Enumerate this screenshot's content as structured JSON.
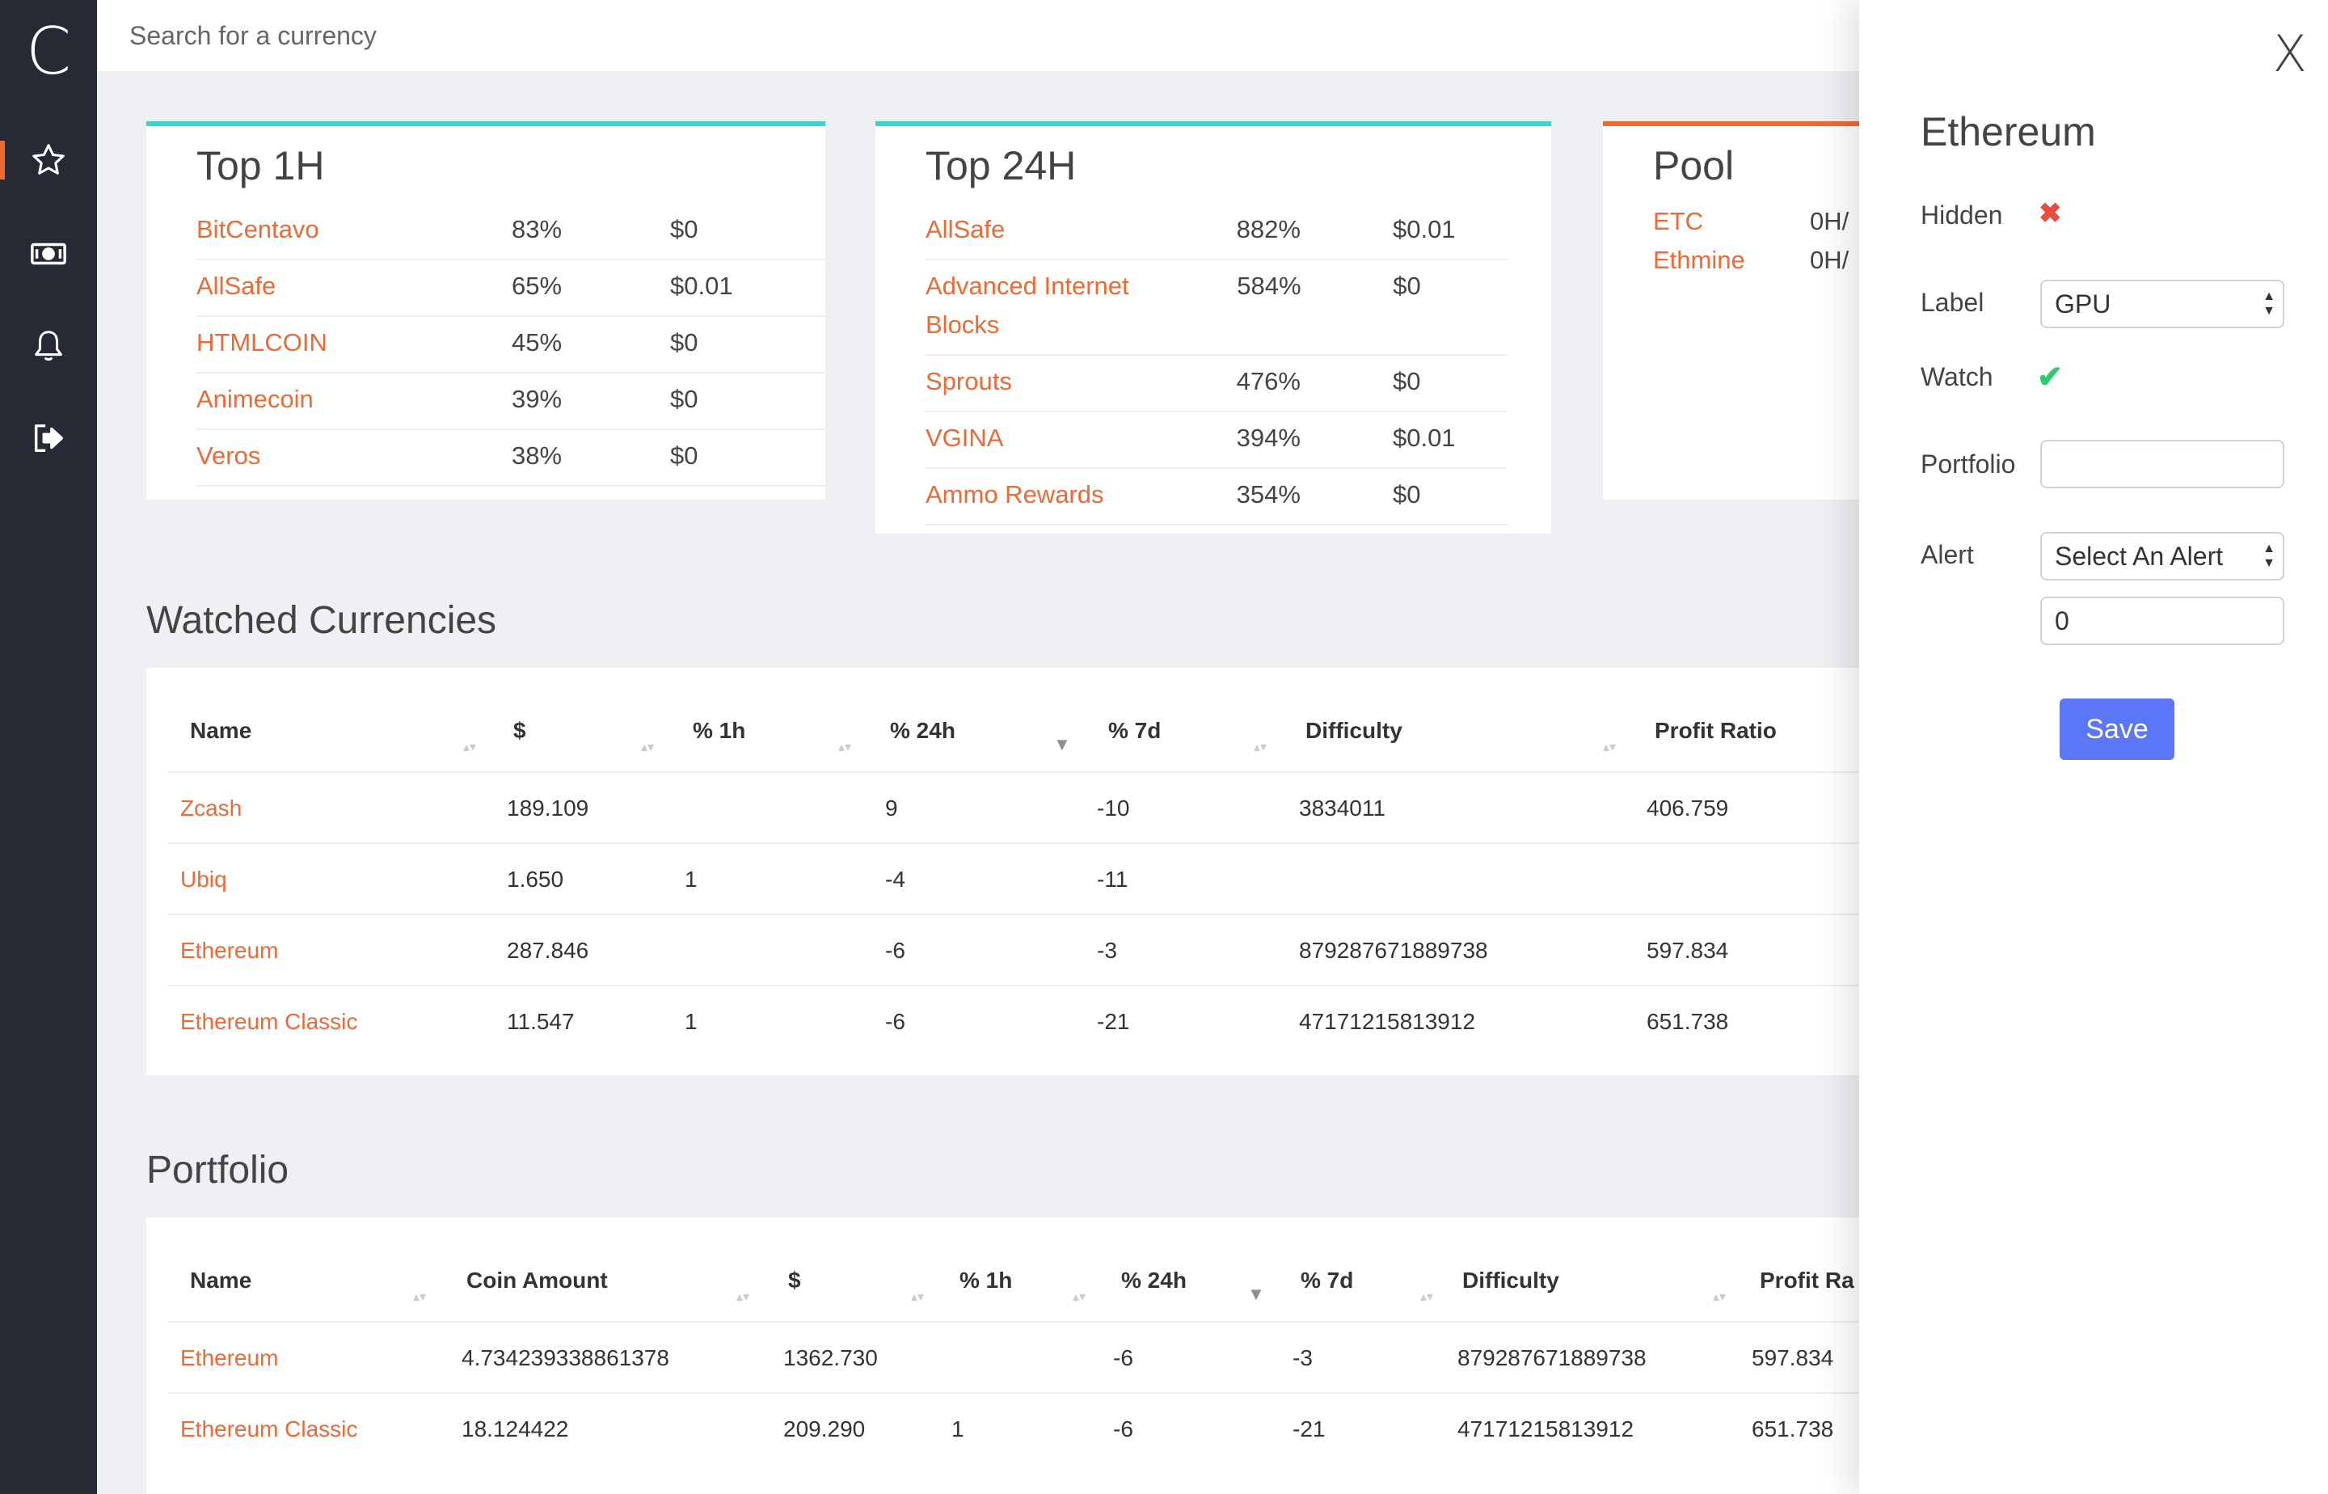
{
  "app": {
    "logo": "C"
  },
  "sidebar": {
    "items": [
      {
        "name": "favorites",
        "icon": "star-icon"
      },
      {
        "name": "money",
        "icon": "money-icon"
      },
      {
        "name": "alerts",
        "icon": "bell-icon"
      },
      {
        "name": "logout",
        "icon": "sign-out-icon"
      }
    ]
  },
  "search": {
    "placeholder": "Search for a currency"
  },
  "top1h": {
    "title": "Top 1H",
    "rows": [
      {
        "name": "BitCentavo",
        "pct": "83%",
        "price": "$0"
      },
      {
        "name": "AllSafe",
        "pct": "65%",
        "price": "$0.01"
      },
      {
        "name": "HTMLCOIN",
        "pct": "45%",
        "price": "$0"
      },
      {
        "name": "Animecoin",
        "pct": "39%",
        "price": "$0"
      },
      {
        "name": "Veros",
        "pct": "38%",
        "price": "$0"
      }
    ]
  },
  "top24h": {
    "title": "Top 24H",
    "rows": [
      {
        "name": "AllSafe",
        "pct": "882%",
        "price": "$0.01"
      },
      {
        "name": "Advanced Internet Blocks",
        "pct": "584%",
        "price": "$0"
      },
      {
        "name": "Sprouts",
        "pct": "476%",
        "price": "$0"
      },
      {
        "name": "VGINA",
        "pct": "394%",
        "price": "$0.01"
      },
      {
        "name": "Ammo Rewards",
        "pct": "354%",
        "price": "$0"
      }
    ]
  },
  "pool": {
    "title": "Pool",
    "rows": [
      {
        "name": "ETC",
        "value": "0H/"
      },
      {
        "name": "Ethmine",
        "value": "0H/"
      }
    ]
  },
  "watched": {
    "title": "Watched Currencies",
    "headers": [
      "Name",
      "$",
      "% 1h",
      "% 24h",
      "% 7d",
      "Difficulty",
      "Profit Ratio"
    ],
    "rows": [
      [
        "Zcash",
        "189.109",
        "",
        "9",
        "-10",
        "3834011",
        "406.759"
      ],
      [
        "Ubiq",
        "1.650",
        "1",
        "-4",
        "-11",
        "",
        ""
      ],
      [
        "Ethereum",
        "287.846",
        "",
        "-6",
        "-3",
        "879287671889738",
        "597.834"
      ],
      [
        "Ethereum Classic",
        "11.547",
        "1",
        "-6",
        "-21",
        "47171215813912",
        "651.738"
      ]
    ]
  },
  "portfolio": {
    "title": "Portfolio",
    "headers": [
      "Name",
      "Coin Amount",
      "$",
      "% 1h",
      "% 24h",
      "% 7d",
      "Difficulty",
      "Profit Ra"
    ],
    "rows": [
      [
        "Ethereum",
        "4.734239338861378",
        "1362.730",
        "",
        "-6",
        "-3",
        "879287671889738",
        "597.834"
      ],
      [
        "Ethereum Classic",
        "18.124422",
        "209.290",
        "1",
        "-6",
        "-21",
        "47171215813912",
        "651.738"
      ]
    ]
  },
  "drawer": {
    "close": "X",
    "title": "Ethereum",
    "hidden_label": "Hidden",
    "hidden_mark": "✖",
    "label_label": "Label",
    "label_value": "GPU",
    "watch_label": "Watch",
    "watch_mark": "✔",
    "portfolio_label": "Portfolio",
    "portfolio_value": "",
    "alert_label": "Alert",
    "alert_value": "Select An Alert",
    "alert_amount": "0",
    "save_label": "Save"
  },
  "colors": {
    "accent": "#ee6a35",
    "teal": "#3dd5c8",
    "sidebar": "#252a35",
    "save": "#5b76f7"
  }
}
